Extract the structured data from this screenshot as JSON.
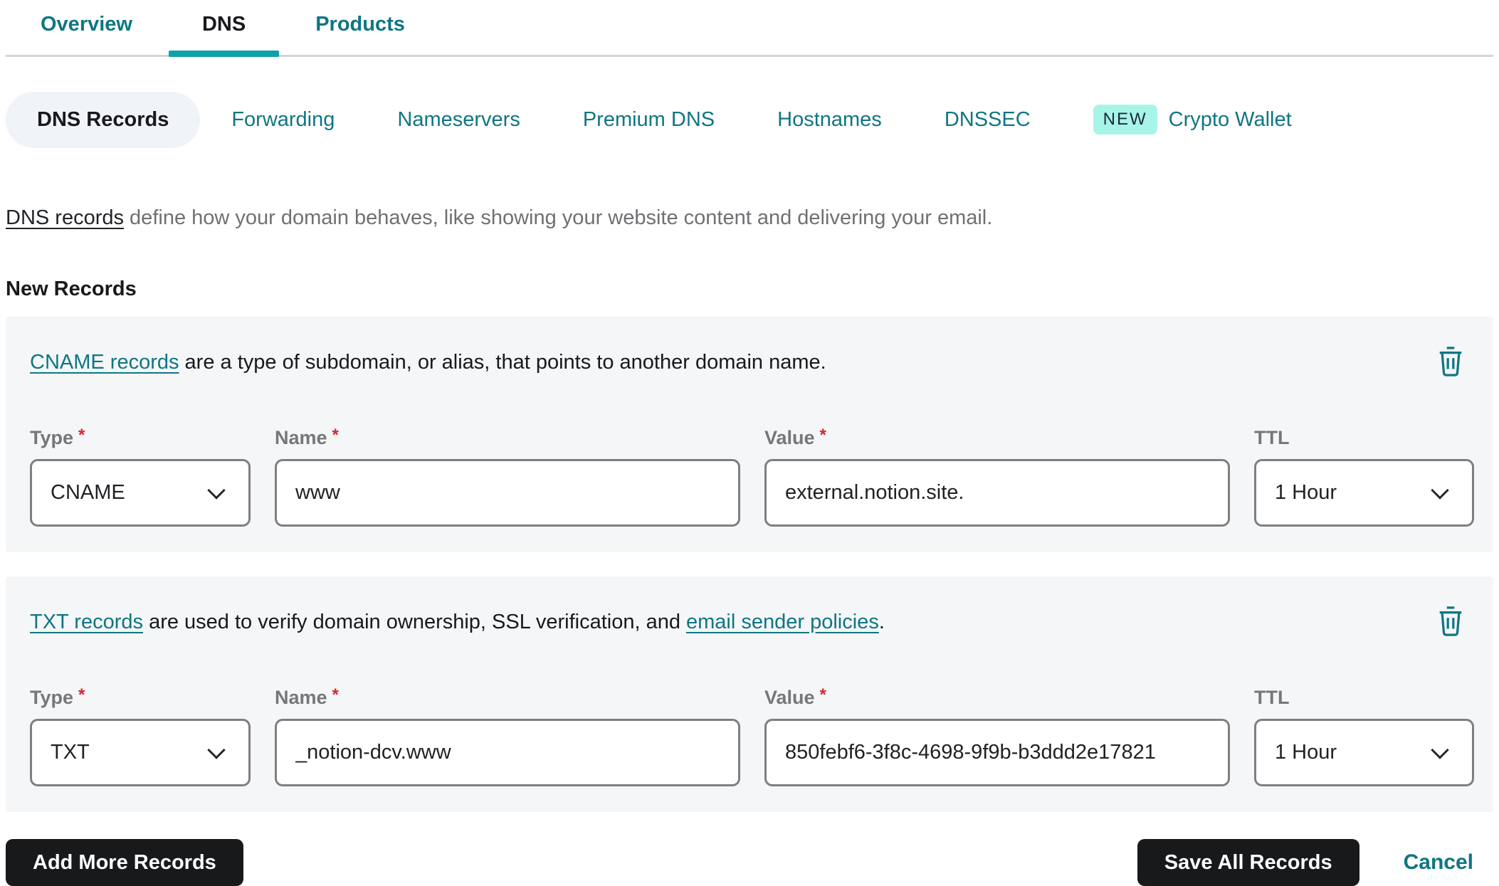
{
  "colors": {
    "accent_teal": "#0da2a8",
    "link_teal": "#0f7682",
    "badge_bg": "#a7f4e9",
    "card_bg": "#f4f6f8",
    "active_pill_bg": "#f0f4f9",
    "required_red": "#d9232e",
    "button_black": "#17191b"
  },
  "tabs": [
    {
      "label": "Overview",
      "active": false
    },
    {
      "label": "DNS",
      "active": true
    },
    {
      "label": "Products",
      "active": false
    }
  ],
  "subtabs": [
    {
      "label": "DNS Records",
      "active": true
    },
    {
      "label": "Forwarding"
    },
    {
      "label": "Nameservers"
    },
    {
      "label": "Premium DNS"
    },
    {
      "label": "Hostnames"
    },
    {
      "label": "DNSSEC"
    },
    {
      "label": "Crypto Wallet",
      "badge": "NEW"
    }
  ],
  "intro": {
    "link_text": "DNS records",
    "text": " define how your domain behaves, like showing your website content and delivering your email."
  },
  "section_title": "New Records",
  "form_labels": {
    "type": "Type",
    "name": "Name",
    "value": "Value",
    "ttl": "TTL",
    "required_mark": "*"
  },
  "records": [
    {
      "description": {
        "link1": "CNAME records",
        "text1": " are a type of subdomain, or alias, that points to another domain name.",
        "link2": "",
        "text2": ""
      },
      "type": "CNAME",
      "name": "www",
      "value": "external.notion.site.",
      "ttl": "1 Hour"
    },
    {
      "description": {
        "link1": "TXT records",
        "text1": " are used to verify domain ownership, SSL verification, and ",
        "link2": "email sender policies",
        "text2": "."
      },
      "type": "TXT",
      "name": "_notion-dcv.www",
      "value": "850febf6-3f8c-4698-9f9b-b3ddd2e17821",
      "ttl": "1 Hour"
    }
  ],
  "footer": {
    "add_button": "Add More Records",
    "save_button": "Save All Records",
    "cancel_link": "Cancel"
  }
}
